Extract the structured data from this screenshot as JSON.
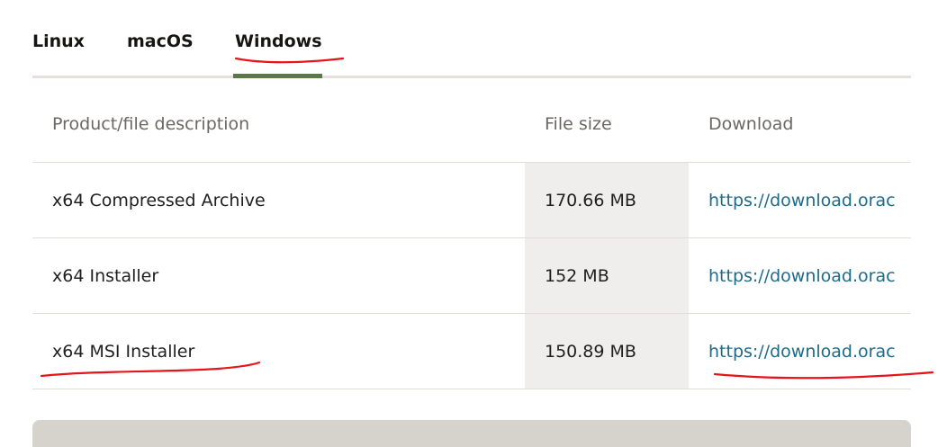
{
  "tabs": [
    {
      "label": "Linux"
    },
    {
      "label": "macOS"
    },
    {
      "label": "Windows"
    }
  ],
  "active_tab": "Windows",
  "table": {
    "headers": {
      "description": "Product/file description",
      "size": "File size",
      "download": "Download"
    },
    "rows": [
      {
        "description": "x64 Compressed Archive",
        "size": "170.66 MB",
        "link": "https://download.orac"
      },
      {
        "description": "x64 Installer",
        "size": "152 MB",
        "link": "https://download.orac"
      },
      {
        "description": "x64 MSI Installer",
        "size": "150.89 MB",
        "link": "https://download.orac"
      }
    ]
  },
  "colors": {
    "active_tab_indicator": "#5b7849",
    "link": "#1d6b8a",
    "annotation": "#e8141c"
  }
}
